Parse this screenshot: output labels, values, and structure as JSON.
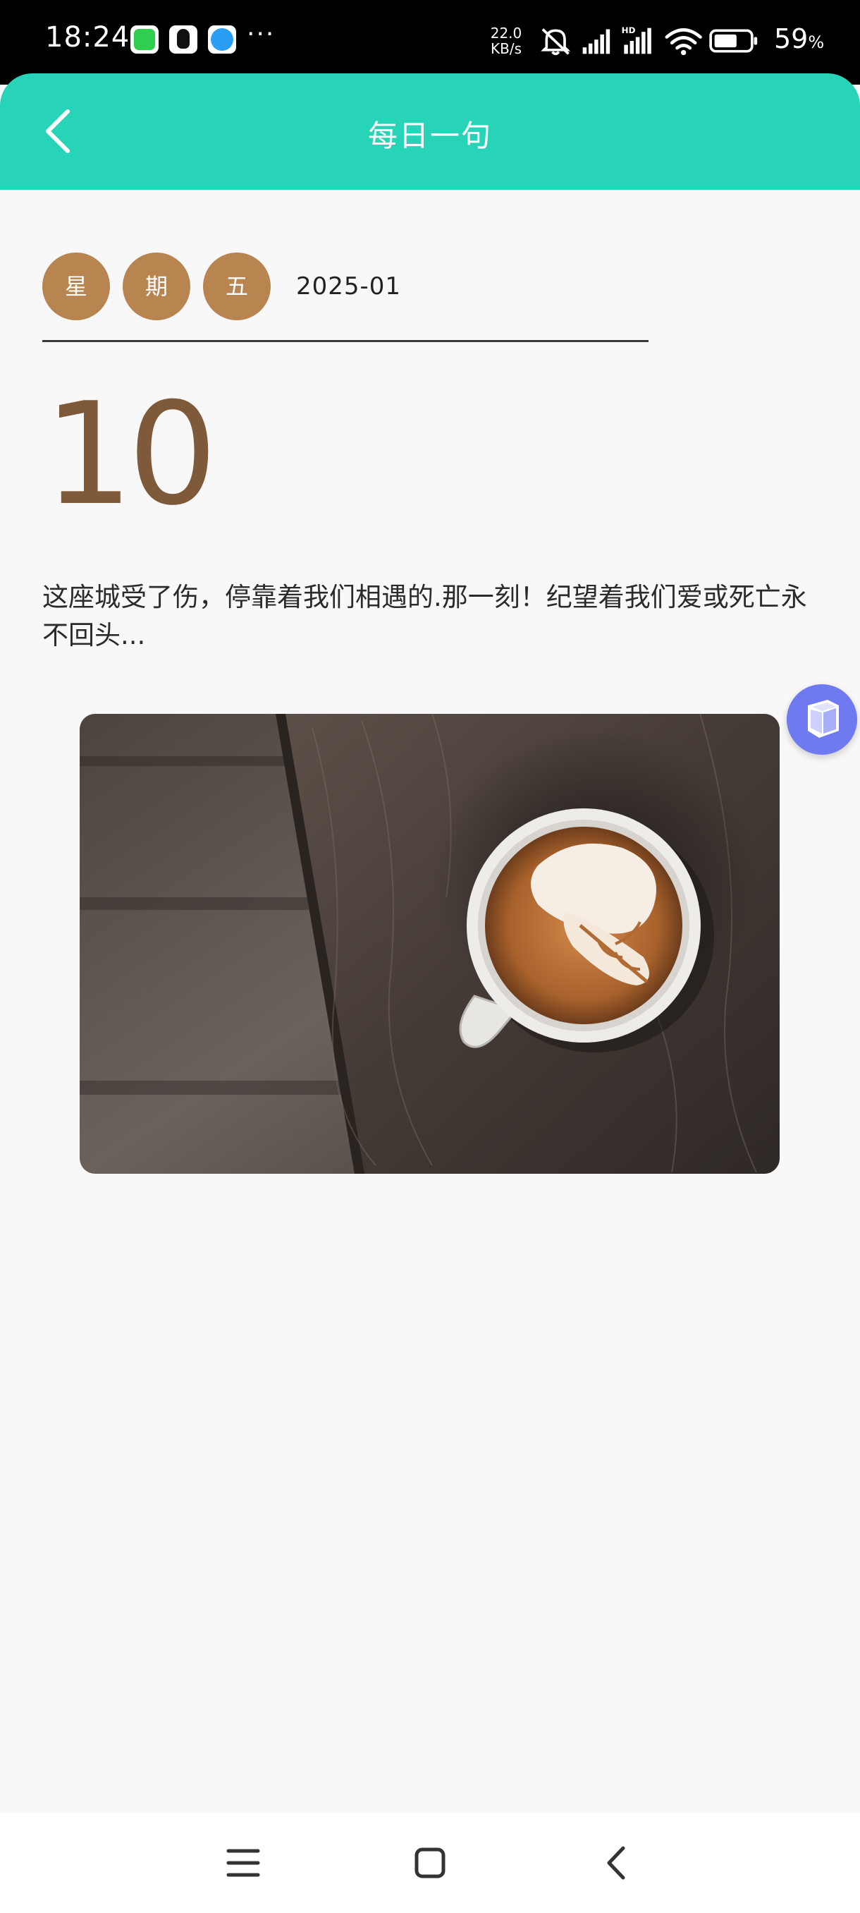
{
  "status_bar": {
    "time": "18:24",
    "more_dots": "···",
    "net_speed_value": "22.0",
    "net_speed_unit": "KB/s",
    "hd_label": "HD",
    "battery_percent": "59",
    "battery_unit": "%"
  },
  "header": {
    "title": "每日一句",
    "back_icon": "chevron-left-icon"
  },
  "date": {
    "weekday_chars": [
      "星",
      "期",
      "五"
    ],
    "year_month": "2025-01",
    "day": "10"
  },
  "quote": {
    "text": "这座城受了伤，停靠着我们相遇的.那一刻！纪望着我们爱或死亡永不回头..."
  },
  "image": {
    "subject": "coffee-latte-art-photo"
  },
  "nav": {
    "items": [
      "menu-icon",
      "home-icon",
      "back-icon"
    ]
  },
  "colors": {
    "header": "#27d4b8",
    "weekday_circle": "#b8844f",
    "day_number": "#7e5a3a",
    "float_widget": "#6f79f0"
  }
}
